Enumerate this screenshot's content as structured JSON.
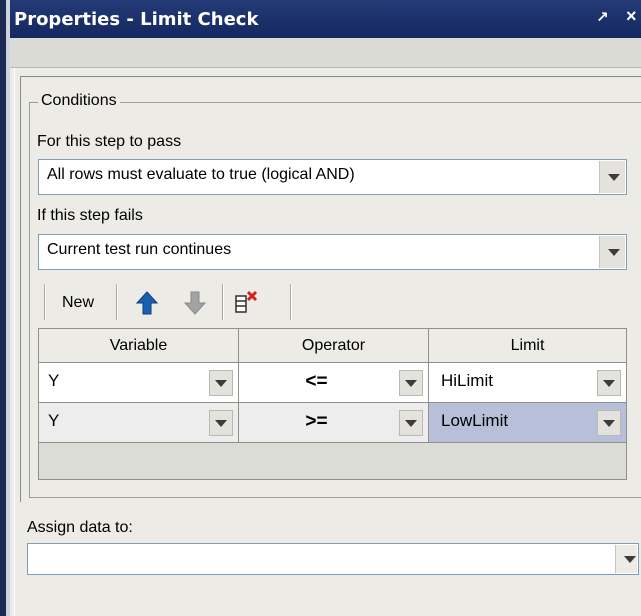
{
  "window": {
    "title": "Properties - Limit Check",
    "pin_glyph": "↗",
    "close_glyph": "×"
  },
  "conditions": {
    "group_label": "Conditions",
    "pass_label": "For this step to pass",
    "pass_value": "All rows must evaluate to true (logical AND)",
    "fail_label": "If this step fails",
    "fail_value": "Current test run continues"
  },
  "toolbar": {
    "new_label": "New",
    "icons": [
      "move-up-icon",
      "move-down-icon",
      "delete-row-icon"
    ]
  },
  "grid": {
    "columns": [
      "Variable",
      "Operator",
      "Limit"
    ],
    "rows": [
      {
        "variable": "Y",
        "operator": "<=",
        "limit": "HiLimit"
      },
      {
        "variable": "Y",
        "operator": ">=",
        "limit": "LowLimit"
      }
    ]
  },
  "assign": {
    "label": "Assign data to:",
    "value": ""
  },
  "colors": {
    "titlebar": "#1c2f69",
    "selected_cell": "#b8bfd9",
    "arrow_up": "#1b5fb0",
    "arrow_down": "#9c9c9c",
    "delete_x": "#d42020"
  }
}
